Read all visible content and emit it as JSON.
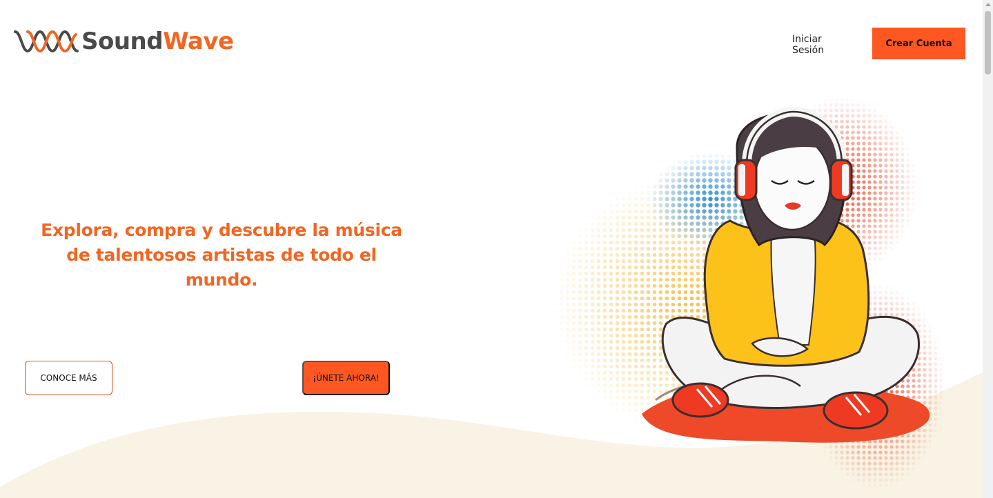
{
  "brand": {
    "name_part1": "Sound",
    "name_part2": "Wave",
    "dark_color": "#4a4a4a",
    "accent_color": "#f26522",
    "logo_icon": "wave-logo-icon"
  },
  "nav": {
    "login_label": "Iniciar Sesión",
    "signup_label": "Crear Cuenta",
    "signup_bg": "#ff5722"
  },
  "hero": {
    "heading": "Explora, compra y descubre la música de talentosos artistas de todo el mundo.",
    "heading_color": "#f26522",
    "learn_more_label": "CONOCE MÁS",
    "join_label": "¡ÚNETE AHORA!",
    "illustration_icon": "girl-with-headphones-illustration",
    "wave_color": "#f8f3e4"
  }
}
